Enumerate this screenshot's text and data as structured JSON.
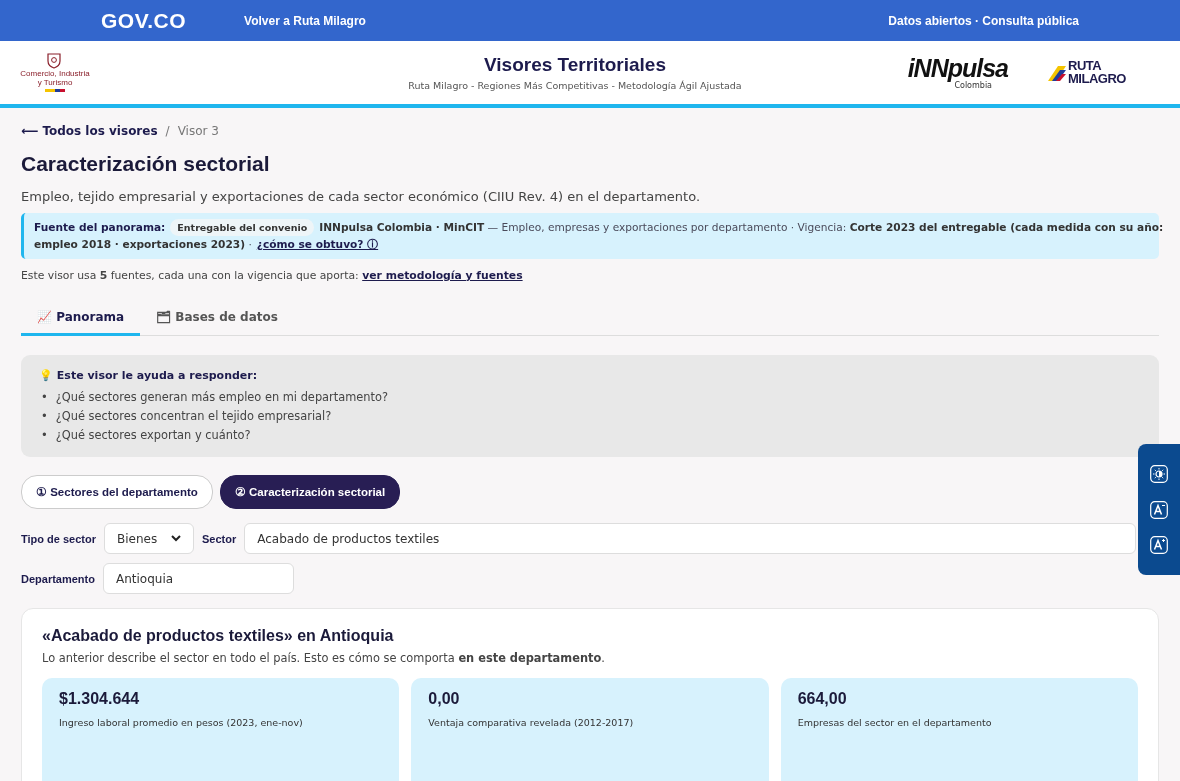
{
  "topbar": {
    "logo": "GOV.CO",
    "back_link": "Volver a Ruta Milagro",
    "right_links": "Datos abiertos · Consulta pública"
  },
  "header": {
    "ministry": "Comercio, Industria y Turismo",
    "title": "Visores Territoriales",
    "subtitle": "Ruta Milagro - Regiones Más Competitivas - Metodología Ágil Ajustada",
    "partner_logos": [
      {
        "kind": "innpulsa",
        "text": "iNNpulsa",
        "sub": "Colombia"
      },
      {
        "kind": "ruta",
        "text": "RUTA MILAGRO"
      }
    ]
  },
  "breadcrumb": {
    "link": "⟵ Todos los visores",
    "separator": "/",
    "current": "Visor 3"
  },
  "page": {
    "title": "Caracterización sectorial",
    "description": "Empleo, tejido empresarial y exportaciones de cada sector económico (CIIU Rev. 4) en el departamento."
  },
  "source_banner": {
    "label": "Fuente del panorama:",
    "chip": "Entregable del convenio",
    "text": "**INNpulsa Colombia · MinCIT** — Empleo, empresas y exportaciones por departamento · Vigencia: **Corte 2023 del entregable (cada medida con su año:**",
    "text_continued": "**empleo 2018 · exportaciones 2023)** ·",
    "link": "¿cómo se obtuvo? ⓘ"
  },
  "sources_note": {
    "text": "Este visor usa **5** fuentes, cada una con la vigencia que aporta:",
    "link": "ver metodología y fuentes"
  },
  "tabs": [
    {
      "icon": "📈",
      "label": "Panorama",
      "selected": true
    },
    {
      "icon": "🗂",
      "label": "Bases de datos",
      "selected": false
    }
  ],
  "questions": {
    "title": "💡 Este visor le ayuda a responder:",
    "bullet": "•",
    "items": [
      "¿Qué sectores generan más empleo en mi departamento?",
      "¿Qué sectores concentran el tejido empresarial?",
      "¿Qué sectores exportan y cuánto?"
    ]
  },
  "steps": [
    {
      "label": "① Sectores del departamento",
      "selected": false
    },
    {
      "label": "② Caracterización sectorial",
      "selected": true
    }
  ],
  "filters": {
    "sector_type": {
      "label": "Tipo de sector",
      "value": "Bienes"
    },
    "sector": {
      "label": "Sector",
      "value": "Acabado de productos textiles"
    },
    "department": {
      "label": "Departamento",
      "value": "Antioquia"
    }
  },
  "result": {
    "title": "«Acabado de productos textiles» en Antioquia",
    "note": "Lo anterior describe el sector en todo el país. Esto es cómo se comporta **en este departamento**.",
    "metrics": [
      {
        "value": "$1.304.644",
        "label": "Ingreso laboral promedio en pesos (2023, ene-nov)"
      },
      {
        "value": "0,00",
        "label": "Ventaja comparativa revelada (2012-2017)"
      },
      {
        "value": "664,00",
        "label": "Empresas del sector en el departamento"
      }
    ]
  },
  "accessibility_tools": [
    {
      "kind": "contrast"
    },
    {
      "kind": "decrease"
    },
    {
      "kind": "increase"
    }
  ]
}
